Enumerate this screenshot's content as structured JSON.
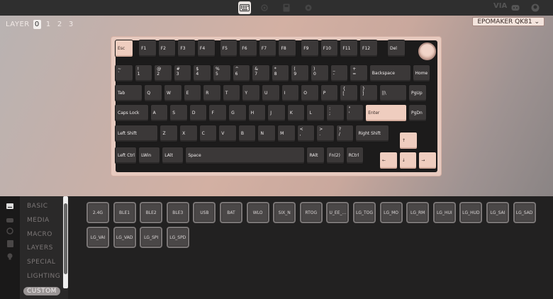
{
  "topbar": {
    "tabs": [
      {
        "name": "keyboard-icon"
      },
      {
        "name": "lighting-icon"
      },
      {
        "name": "save-icon"
      },
      {
        "name": "settings-icon"
      }
    ],
    "right_icons": [
      "VIA",
      "discord-icon",
      "github-icon"
    ]
  },
  "layers": {
    "label": "LAYER",
    "items": [
      "0",
      "1",
      "2",
      "3"
    ],
    "active": "0"
  },
  "device_select": {
    "value": "EPOMAKER QK81 ⌄"
  },
  "keyboard": {
    "rows": [
      [
        "Esc",
        "F1",
        "F2",
        "F3",
        "F4",
        "F5",
        "F6",
        "F7",
        "F8",
        "F9",
        "F10",
        "F11",
        "F12",
        "Del"
      ],
      [
        "~|`",
        "!|1",
        "@|2",
        "#|3",
        "$|4",
        "%|5",
        "^|6",
        "&|7",
        "*|8",
        "(|9",
        ")|0",
        "_|-",
        "+|=",
        "Backspace",
        "Home"
      ],
      [
        "Tab",
        "Q",
        "W",
        "E",
        "R",
        "T",
        "Y",
        "U",
        "I",
        "O",
        "P",
        "{|[",
        "}|]",
        "||\\",
        "PgUp"
      ],
      [
        "Caps Lock",
        "A",
        "S",
        "D",
        "F",
        "G",
        "H",
        "J",
        "K",
        "L",
        ":|;",
        "\"|'",
        "Enter",
        "PgDn"
      ],
      [
        "Left Shift",
        "Z",
        "X",
        "C",
        "V",
        "B",
        "N",
        "M",
        "<|,",
        ">|.",
        "?|/",
        "Right Shift",
        "↑"
      ],
      [
        "Left Ctrl",
        "LWin",
        "LAlt",
        "Space",
        "RAlt",
        "Fn(2)",
        "RCtrl",
        "←",
        "↓",
        "→"
      ]
    ]
  },
  "menu": {
    "items": [
      "BASIC",
      "MEDIA",
      "MACRO",
      "LAYERS",
      "SPECIAL",
      "LIGHTING",
      "CUSTOM"
    ],
    "active": "CUSTOM"
  },
  "custom_keys": [
    "2.4G",
    "BLE1",
    "BLE2",
    "BLE3",
    "USB",
    "BAT",
    "WLO",
    "SIX_N",
    "RTOG",
    "U_EE_...",
    "LG_TOG",
    "LG_MO",
    "LG_RM",
    "LG_HUI",
    "LG_HUD",
    "LG_SAI",
    "LG_SAD",
    "LG_VAI",
    "LG_VAD",
    "LG_SPI",
    "LG_SPD"
  ],
  "colors": {
    "accent_key": "#efcdbf",
    "key": "#3b3838",
    "case": "#e7cabf"
  }
}
